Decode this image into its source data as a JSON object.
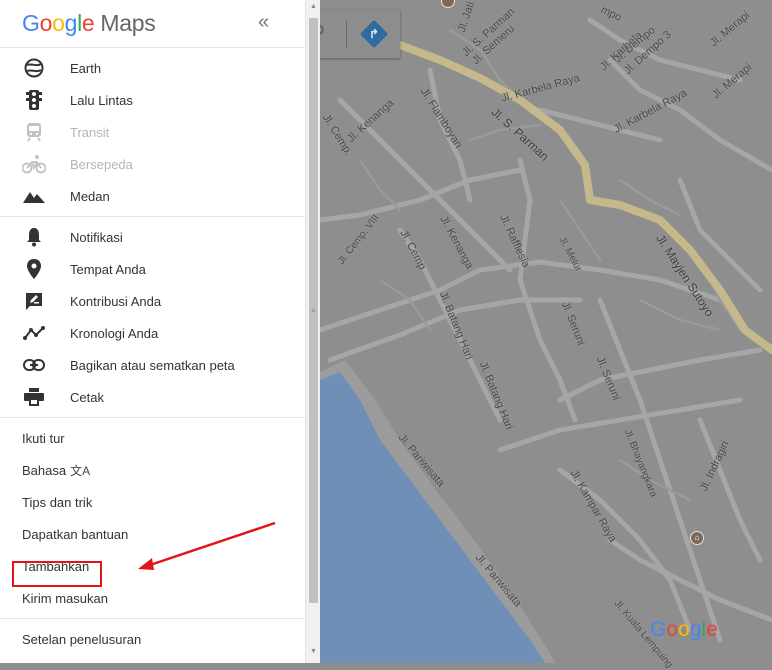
{
  "app": {
    "logo_google": "Google",
    "logo_maps": "Maps",
    "collapse_glyph": "«"
  },
  "layers": [
    {
      "label": "Earth",
      "icon": "earth-icon",
      "enabled": true
    },
    {
      "label": "Lalu Lintas",
      "icon": "traffic-light-icon",
      "enabled": true
    },
    {
      "label": "Transit",
      "icon": "train-icon",
      "enabled": false
    },
    {
      "label": "Bersepeda",
      "icon": "bicycle-icon",
      "enabled": false
    },
    {
      "label": "Medan",
      "icon": "terrain-icon",
      "enabled": true
    }
  ],
  "personal": [
    {
      "label": "Notifikasi",
      "icon": "bell-icon"
    },
    {
      "label": "Tempat Anda",
      "icon": "location-pin-icon"
    },
    {
      "label": "Kontribusi Anda",
      "icon": "edit-icon"
    },
    {
      "label": "Kronologi Anda",
      "icon": "timeline-icon"
    },
    {
      "label": "Bagikan atau sematkan peta",
      "icon": "link-icon"
    },
    {
      "label": "Cetak",
      "icon": "printer-icon"
    }
  ],
  "help": [
    {
      "label": "Ikuti tur"
    },
    {
      "label": "Bahasa",
      "suffix_icon": "translate-icon"
    },
    {
      "label": "Tips dan trik"
    },
    {
      "label": "Dapatkan bantuan"
    },
    {
      "label": "Tambahkan",
      "highlighted": true
    },
    {
      "label": "Kirim masukan"
    }
  ],
  "footer": {
    "settings_label": "Setelan penelusuran"
  },
  "map": {
    "streets": [
      "Jl. Jati",
      "Jl. S. Parman",
      "Jl. Semeru",
      "Jl. Dempo",
      "Jl. Karbela",
      "Jl. Dempo 3",
      "Jl. Merapi",
      "Jl. Merapi",
      "Jl. Karbela Raya",
      "Jl. Karbela Raya",
      "Jl. Flamboyan",
      "Jl. Kenanga",
      "Jl. Cemp.",
      "Jl. S. Parman",
      "Jl. Mayjen Sutoyo",
      "Jl. Cemp. VIII",
      "Jl. Cemp",
      "Jl. Kenanga",
      "Jl. Rafflesia",
      "Jl. Melur",
      "Jl. Batang Hari",
      "Jl. Batang Hari",
      "Jl. Seruni",
      "Jl. Seruni",
      "Jl. Bhayangkara",
      "Jl. Indragiri",
      "Jl. Pariwisata",
      "Jl. Kampar Raya",
      "Jl. Pariwisata",
      "Jl. Kuala Lempuing",
      "mpo"
    ],
    "google_logo": "Google"
  },
  "colors": {
    "map_bg": "#8e8e8e",
    "road": "#a3a3a3",
    "major_road": "#c5b88a",
    "sea": "#6f8fb7",
    "highlight_box": "#e2141a",
    "arrow": "#e2141a"
  }
}
